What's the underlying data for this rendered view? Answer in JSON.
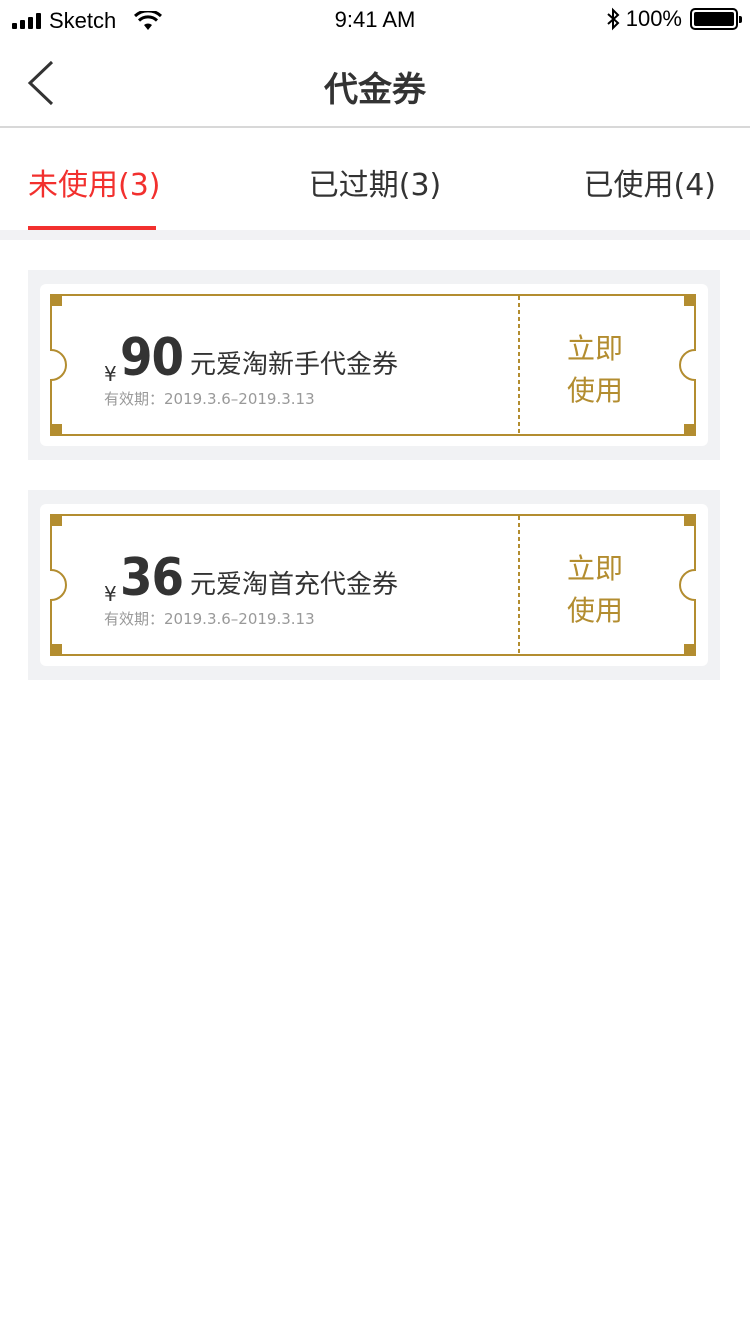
{
  "status_bar": {
    "carrier": "Sketch",
    "time": "9:41 AM",
    "battery": "100%"
  },
  "nav": {
    "title": "代金券"
  },
  "tabs": [
    {
      "label": "未使用(3)",
      "active": true
    },
    {
      "label": "已过期(3)",
      "active": false
    },
    {
      "label": "已使用(4)",
      "active": false
    }
  ],
  "coupons": [
    {
      "currency": "¥",
      "amount": "90",
      "name": "元爱淘新手代金券",
      "validity": "有效期：2019.3.6–2019.3.13",
      "action_line1": "立即",
      "action_line2": "使用"
    },
    {
      "currency": "¥",
      "amount": "36",
      "name": "元爱淘首充代金券",
      "validity": "有效期：2019.3.6–2019.3.13",
      "action_line1": "立即",
      "action_line2": "使用"
    }
  ],
  "colors": {
    "accent_red": "#f2302e",
    "gold": "#b38d30",
    "text": "#333333",
    "muted": "#999999"
  }
}
